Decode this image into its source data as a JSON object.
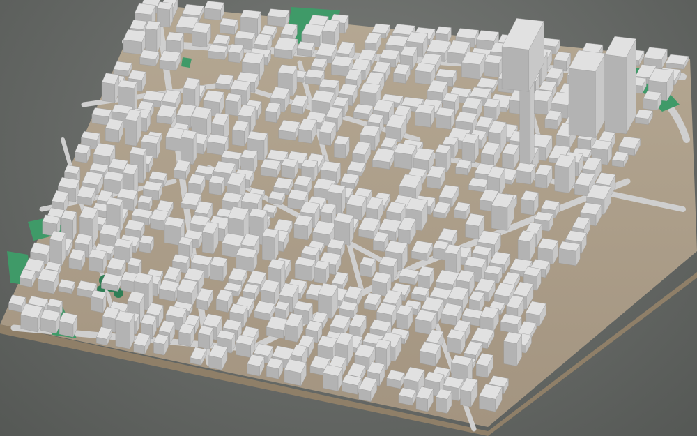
{
  "scene": {
    "label": "",
    "colors": {
      "background": "#676a66",
      "base_top": "#a89a86",
      "base_front": "#9a8a73",
      "base_side": "#8b7c68",
      "road": "#c9c9c9",
      "building_top": "#e1e1e1",
      "building_left": "#b3b3b3",
      "building_right": "#c8c8c8",
      "park": "#3f9a68",
      "tree": "#2f7e55"
    },
    "elements": {
      "base": "terrain-base",
      "roads": "street-network",
      "parks": "green-spaces",
      "buildings": "building-blocks",
      "towers": "high-rise-towers"
    }
  }
}
